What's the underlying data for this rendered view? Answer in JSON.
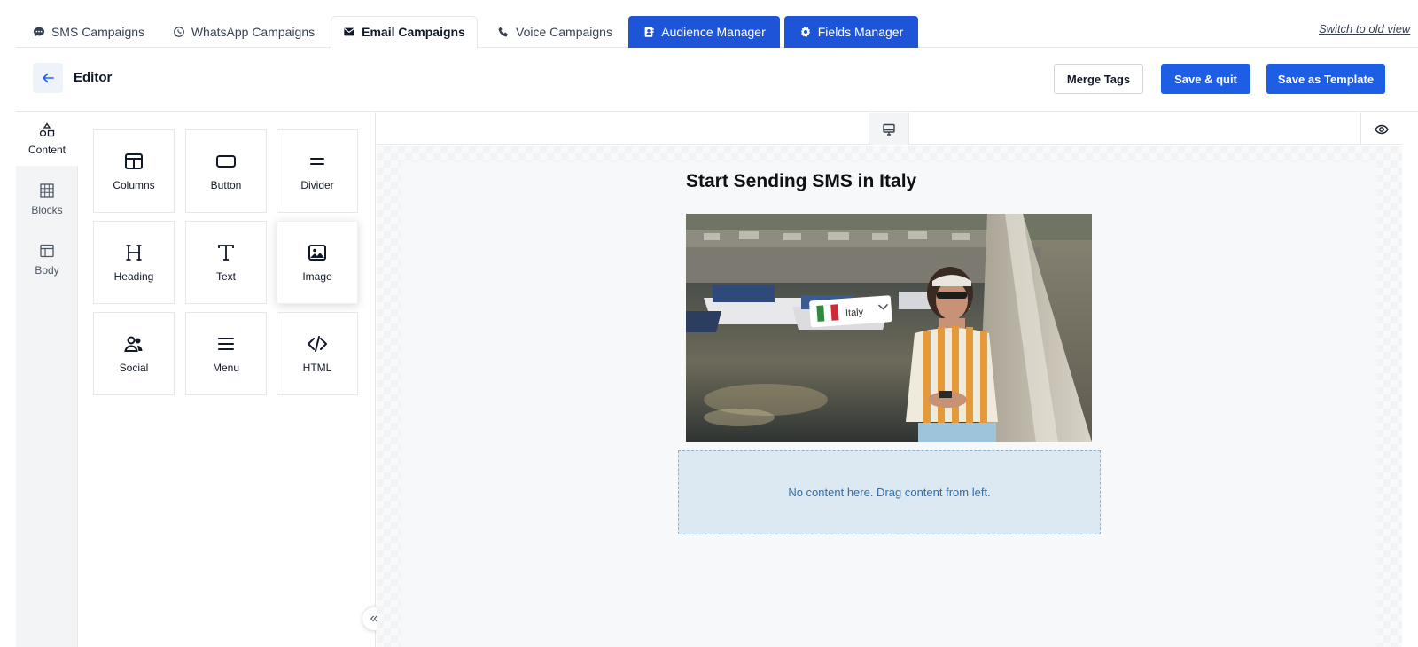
{
  "tabs": [
    {
      "label": "SMS Campaigns",
      "icon": "chat-bubble-icon"
    },
    {
      "label": "WhatsApp Campaigns",
      "icon": "whatsapp-icon"
    },
    {
      "label": "Email Campaigns",
      "icon": "envelope-icon",
      "active": true
    },
    {
      "label": "Voice Campaigns",
      "icon": "phone-icon"
    },
    {
      "label": "Audience Manager",
      "icon": "address-book-icon"
    },
    {
      "label": "Fields Manager",
      "icon": "gear-icon"
    }
  ],
  "switch_link": "Switch to old view",
  "editor": {
    "title": "Editor",
    "merge_tags": "Merge Tags",
    "save_quit": "Save & quit",
    "save_template": "Save as Template"
  },
  "rail": [
    {
      "label": "Content",
      "icon": "shapes-icon",
      "active": true
    },
    {
      "label": "Blocks",
      "icon": "blocks-icon"
    },
    {
      "label": "Body",
      "icon": "layout-icon"
    }
  ],
  "tools": [
    {
      "label": "Columns",
      "icon": "columns-icon"
    },
    {
      "label": "Button",
      "icon": "button-icon"
    },
    {
      "label": "Divider",
      "icon": "divider-icon"
    },
    {
      "label": "Heading",
      "icon": "heading-icon"
    },
    {
      "label": "Text",
      "icon": "text-icon"
    },
    {
      "label": "Image",
      "icon": "image-icon"
    },
    {
      "label": "Social",
      "icon": "users-icon"
    },
    {
      "label": "Menu",
      "icon": "menu-icon"
    },
    {
      "label": "HTML",
      "icon": "code-icon"
    }
  ],
  "canvas": {
    "email_title": "Start Sending SMS in Italy",
    "image_tag": "Italy",
    "dropzone_text": "No content here. Drag content from left."
  },
  "colors": {
    "primary": "#1e5ee5",
    "tab_primary": "#1e55d8",
    "dropzone": "#dce9f2"
  }
}
